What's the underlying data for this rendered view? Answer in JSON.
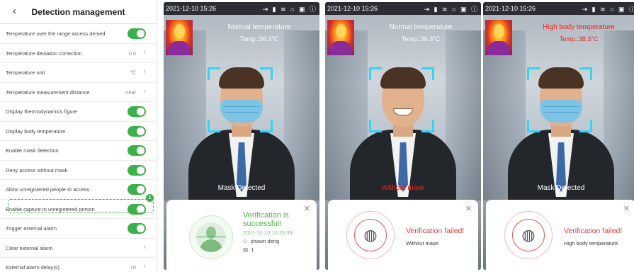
{
  "settings": {
    "title": "Detection management",
    "back_glyph": "‹",
    "rows": [
      {
        "label": "Temperature over the range access denied",
        "control": "toggle",
        "on": true
      },
      {
        "label": "Temperature deviation correction",
        "control": "value",
        "value": "0.0"
      },
      {
        "label": "Temperature unit",
        "control": "value",
        "value": "℃"
      },
      {
        "label": "Temperature measurement distance",
        "control": "value",
        "value": "near"
      },
      {
        "label": "Display thermodynamics figure",
        "control": "toggle",
        "on": true
      },
      {
        "label": "Display body temperature",
        "control": "toggle",
        "on": true
      },
      {
        "label": "Enable mask detection",
        "control": "toggle",
        "on": true
      },
      {
        "label": "Deny access without mask",
        "control": "toggle",
        "on": true
      },
      {
        "label": "Allow unregistered people to access",
        "control": "toggle",
        "on": true
      },
      {
        "label": "Enable capture to unregistered person",
        "control": "toggle",
        "on": true
      },
      {
        "label": "Trigger external alarm",
        "control": "toggle",
        "on": true
      },
      {
        "label": "Clear external alarm",
        "control": "chevron"
      },
      {
        "label": "External alarm delay(s)",
        "control": "value",
        "value": "10"
      }
    ],
    "highlight_badge": "1",
    "chevron_glyph": "›"
  },
  "screens": [
    {
      "time": "2021-12-10 15:26",
      "temp_status": "Normal temperature",
      "temp_value": "Temp.:36.3°C",
      "temp_alert": false,
      "mask_status": "Mask Detected",
      "mask_alert": false,
      "wearing_mask": true,
      "result": {
        "kind": "success",
        "title": "Verification is successful!",
        "timestamp": "2021-12-10 15:26:38",
        "user": "shawn deng",
        "id": "1"
      }
    },
    {
      "time": "2021-12-10 15:26",
      "temp_status": "Normal temperature",
      "temp_value": "Temp.:36.3°C",
      "temp_alert": false,
      "mask_status": "Without mask",
      "mask_alert": true,
      "wearing_mask": false,
      "result": {
        "kind": "fail",
        "title": "Verification failed!",
        "reason": "Without masK"
      }
    },
    {
      "time": "2021-12-10 15:26",
      "temp_status": "High body temperature",
      "temp_value": "Temp.:38.3°C",
      "temp_alert": true,
      "mask_status": "Mask Detected",
      "mask_alert": false,
      "wearing_mask": true,
      "result": {
        "kind": "fail",
        "title": "Verification failed!",
        "reason": "High body temperature"
      }
    }
  ],
  "icons": {
    "status_bar": "⇥ ▮ ≋ ⌂ ▣ ⓘ",
    "close": "✕",
    "user": "⚇",
    "id_card": "▤",
    "fingerprint_face": "◍"
  },
  "colors": {
    "accent_green": "#3cb14a",
    "alert_red": "#e03b34",
    "frame_cyan": "#33d6f0"
  }
}
